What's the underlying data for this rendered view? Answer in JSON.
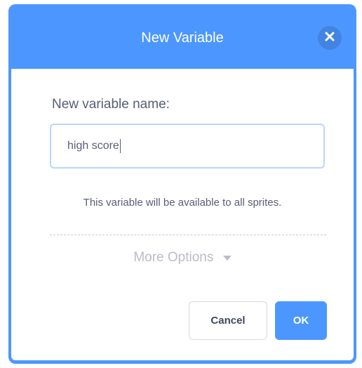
{
  "dialog": {
    "title": "New Variable",
    "close_icon": "close-icon",
    "label": "New variable name:",
    "input_value": "high score",
    "info_text": "This variable will be available to all sprites.",
    "more_options_label": "More Options",
    "more_options_icon": "caret-down-icon",
    "cancel_label": "Cancel",
    "ok_label": "OK"
  },
  "colors": {
    "header": "#4c97ff",
    "text": "#575e75",
    "input_border": "#b9d6ff",
    "ok_button": "#4c97ff"
  }
}
